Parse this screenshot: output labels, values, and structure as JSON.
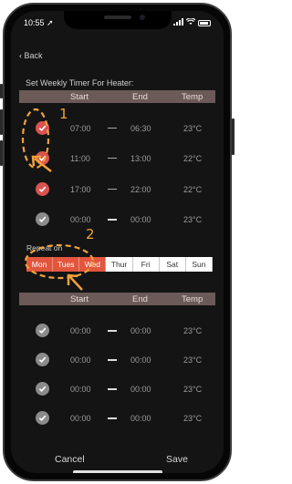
{
  "status": {
    "time": "10:55"
  },
  "nav": {
    "back_label": "Back"
  },
  "title": "Set Weekly Timer For Heater:",
  "table": {
    "headers": {
      "start": "Start",
      "end": "End",
      "temp": "Temp"
    },
    "rows": [
      {
        "checked": true,
        "start": "07:00",
        "end": "06:30",
        "temp": "23°C"
      },
      {
        "checked": true,
        "start": "11:00",
        "end": "13:00",
        "temp": "22°C"
      },
      {
        "checked": true,
        "start": "17:00",
        "end": "22:00",
        "temp": "22°C"
      },
      {
        "checked": false,
        "start": "00:00",
        "end": "00:00",
        "temp": "23°C"
      }
    ]
  },
  "repeat": {
    "label": "Repeat on",
    "days": [
      {
        "label": "Mon",
        "selected": true
      },
      {
        "label": "Tues",
        "selected": true
      },
      {
        "label": "Wed",
        "selected": true
      },
      {
        "label": "Thur",
        "selected": false
      },
      {
        "label": "Fri",
        "selected": false
      },
      {
        "label": "Sat",
        "selected": false
      },
      {
        "label": "Sun",
        "selected": false
      }
    ]
  },
  "table2": {
    "headers": {
      "start": "Start",
      "end": "End",
      "temp": "Temp"
    },
    "rows": [
      {
        "checked": false,
        "start": "00:00",
        "end": "00:00",
        "temp": "23°C"
      },
      {
        "checked": false,
        "start": "00:00",
        "end": "00:00",
        "temp": "23°C"
      },
      {
        "checked": false,
        "start": "00:00",
        "end": "00:00",
        "temp": "23°C"
      },
      {
        "checked": false,
        "start": "00:00",
        "end": "00:00",
        "temp": "23°C"
      }
    ]
  },
  "annotations": {
    "one": "1",
    "two": "2"
  },
  "footer": {
    "cancel_label": "Cancel",
    "save_label": "Save"
  },
  "colors": {
    "accent": "#e3563e",
    "check_on": "#d9534f",
    "header_bar": "#6c5a58",
    "annotation": "#f0a23a"
  },
  "icons": [
    "chevron-left-icon",
    "signal-icon",
    "wifi-icon",
    "battery-icon",
    "checkmark-icon"
  ]
}
